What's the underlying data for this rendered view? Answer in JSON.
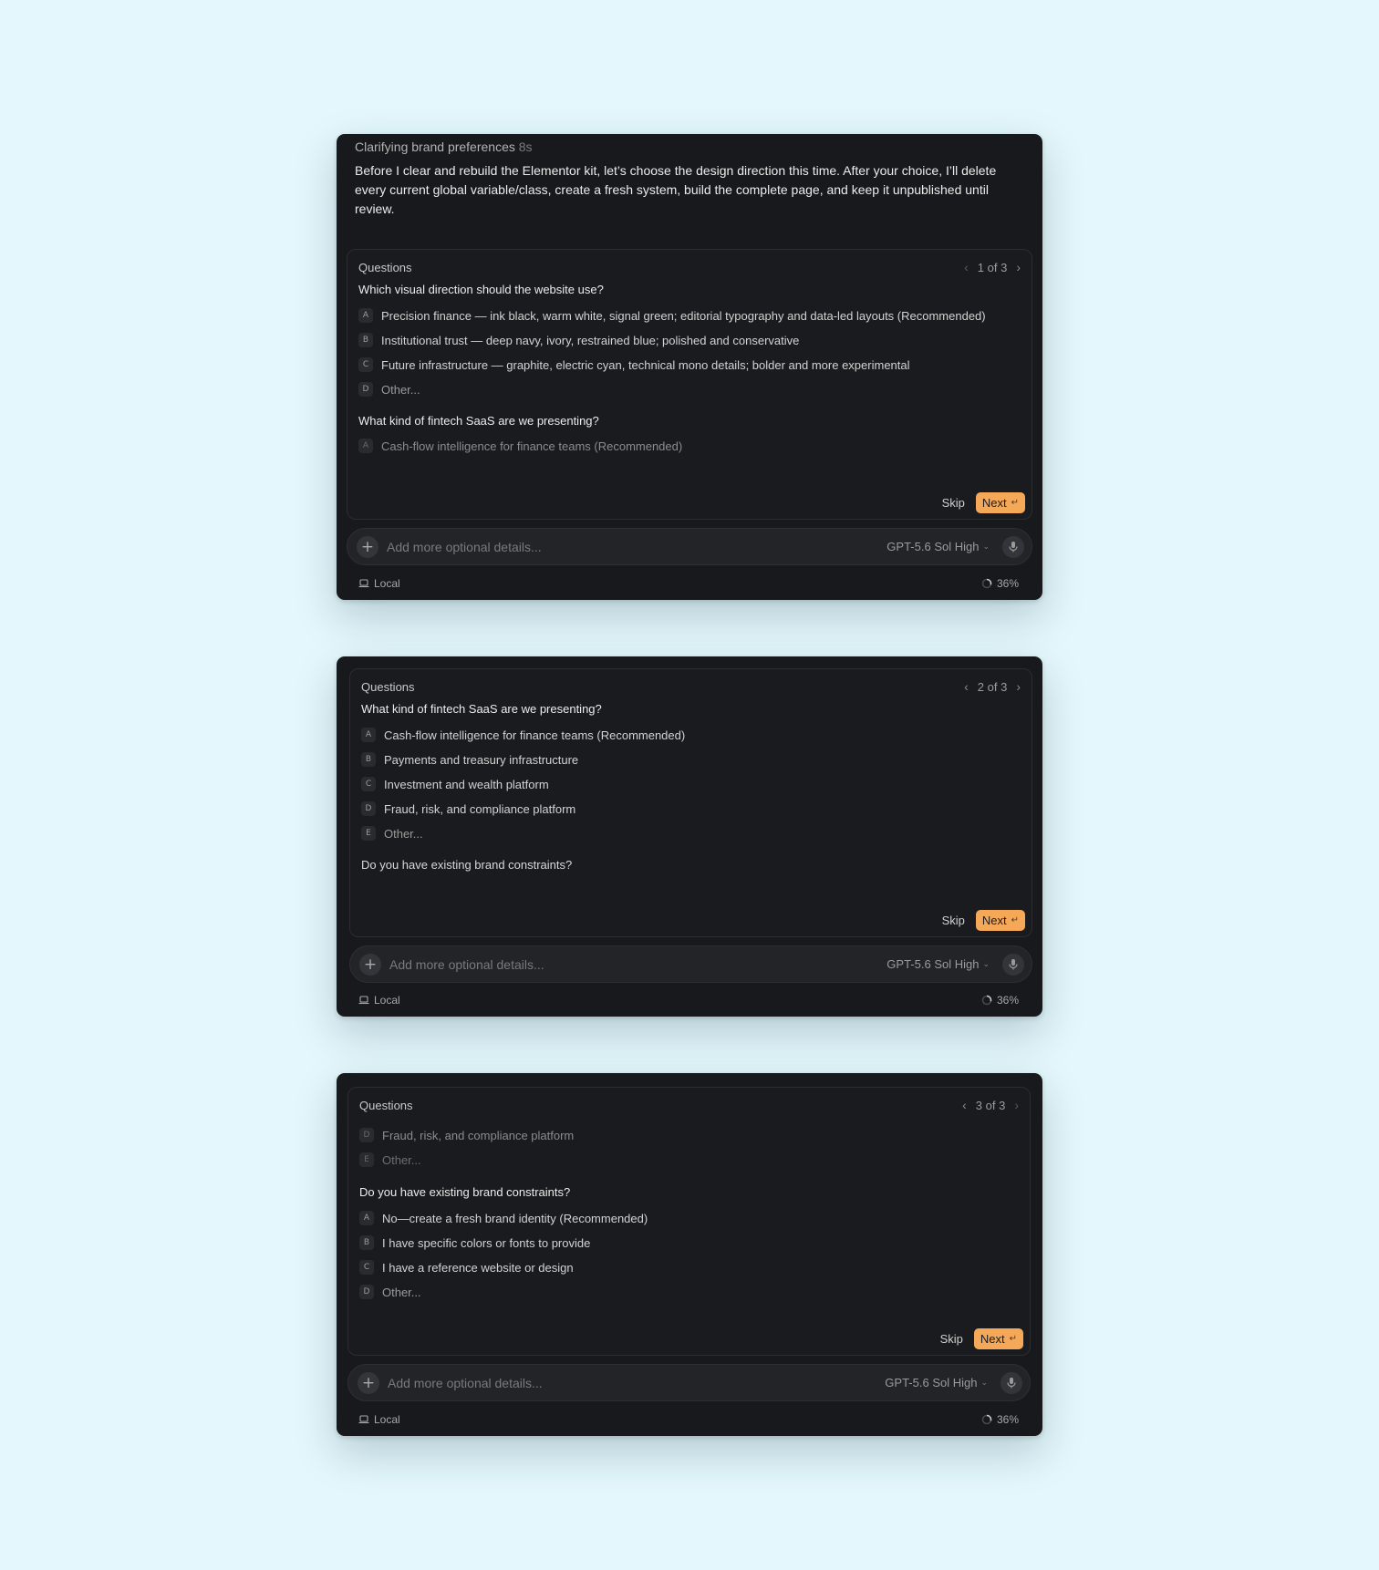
{
  "colors": {
    "background": "#e3f7fc",
    "panel": "#18191c",
    "accent": "#f4a858"
  },
  "panel1": {
    "status_label": "Clarifying brand preferences",
    "status_time": "8s",
    "message": "Before I clear and rebuild the Elementor kit, let’s choose the design direction this time. After your choice, I’ll delete every current global variable/class, create a fresh system, build the complete page, and keep it unpublished until review.",
    "questions_title": "Questions",
    "pager": "1 of 3",
    "q1": "Which visual direction should the website use?",
    "q1_options": [
      {
        "key": "A",
        "label": "Precision finance — ink black, warm white, signal green; editorial typography and data-led layouts (Recommended)"
      },
      {
        "key": "B",
        "label": "Institutional trust — deep navy, ivory, restrained blue; polished and conservative"
      },
      {
        "key": "C",
        "label": "Future infrastructure — graphite, electric cyan, technical mono details; bolder and more experimental"
      },
      {
        "key": "D",
        "label": "Other..."
      }
    ],
    "q2": "What kind of fintech SaaS are we presenting?",
    "q2_options": [
      {
        "key": "A",
        "label": "Cash-flow intelligence for finance teams (Recommended)"
      }
    ],
    "skip": "Skip",
    "next": "Next",
    "placeholder": "Add more optional details...",
    "model": "GPT-5.6 Sol High",
    "location": "Local",
    "progress": "36%"
  },
  "panel2": {
    "questions_title": "Questions",
    "pager": "2 of 3",
    "q1": "What kind of fintech SaaS are we presenting?",
    "q1_options": [
      {
        "key": "A",
        "label": "Cash-flow intelligence for finance teams (Recommended)"
      },
      {
        "key": "B",
        "label": "Payments and treasury infrastructure"
      },
      {
        "key": "C",
        "label": "Investment and wealth platform"
      },
      {
        "key": "D",
        "label": "Fraud, risk, and compliance platform"
      },
      {
        "key": "E",
        "label": "Other..."
      }
    ],
    "q2": "Do you have existing brand constraints?",
    "skip": "Skip",
    "next": "Next",
    "placeholder": "Add more optional details...",
    "model": "GPT-5.6 Sol High",
    "location": "Local",
    "progress": "36%"
  },
  "panel3": {
    "questions_title": "Questions",
    "pager": "3 of 3",
    "prev_options": [
      {
        "key": "D",
        "label": "Fraud, risk, and compliance platform"
      },
      {
        "key": "E",
        "label": "Other..."
      }
    ],
    "q1": "Do you have existing brand constraints?",
    "q1_options": [
      {
        "key": "A",
        "label": "No—create a fresh brand identity (Recommended)"
      },
      {
        "key": "B",
        "label": "I have specific colors or fonts to provide"
      },
      {
        "key": "C",
        "label": "I have a reference website or design"
      },
      {
        "key": "D",
        "label": "Other..."
      }
    ],
    "skip": "Skip",
    "next": "Next",
    "placeholder": "Add more optional details...",
    "model": "GPT-5.6 Sol High",
    "location": "Local",
    "progress": "36%"
  }
}
